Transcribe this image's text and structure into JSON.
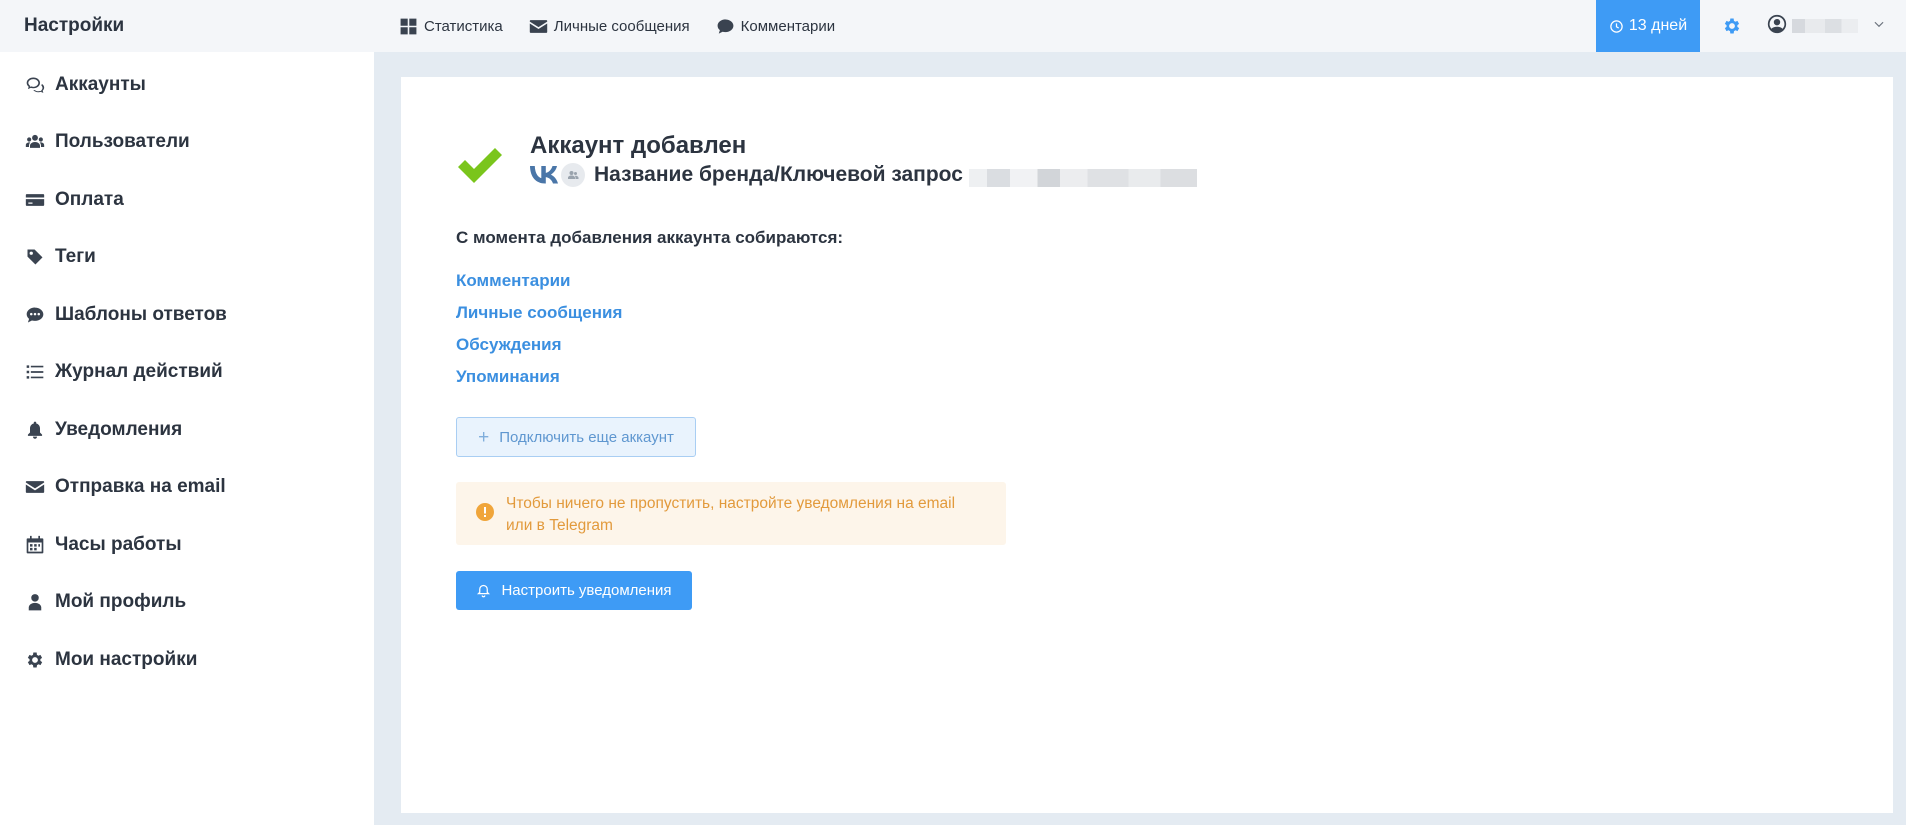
{
  "sidebar": {
    "title": "Настройки",
    "items": [
      {
        "label": "Аккаунты",
        "icon": "chat-icon"
      },
      {
        "label": "Пользователи",
        "icon": "users-icon"
      },
      {
        "label": "Оплата",
        "icon": "credit-card-icon"
      },
      {
        "label": "Теги",
        "icon": "tag-icon"
      },
      {
        "label": "Шаблоны ответов",
        "icon": "comment-dots-icon"
      },
      {
        "label": "Журнал действий",
        "icon": "list-icon"
      },
      {
        "label": "Уведомления",
        "icon": "bell-icon"
      },
      {
        "label": "Отправка на email",
        "icon": "envelope-icon"
      },
      {
        "label": "Часы работы",
        "icon": "calendar-icon"
      },
      {
        "label": "Мой профиль",
        "icon": "user-icon"
      },
      {
        "label": "Мои настройки",
        "icon": "gear-icon"
      }
    ]
  },
  "topbar": {
    "nav": [
      {
        "label": "Статистика",
        "icon": "grid-icon"
      },
      {
        "label": "Личные сообщения",
        "icon": "envelope-icon"
      },
      {
        "label": "Комментарии",
        "icon": "comment-icon"
      }
    ],
    "trial": "13 дней"
  },
  "main": {
    "title": "Аккаунт добавлен",
    "account_name": "Название бренда/Ключевой запрос",
    "collect_label": "С момента добавления аккаунта собираются:",
    "collect_items": [
      "Комментарии",
      "Личные сообщения",
      "Обсуждения",
      "Упоминания"
    ],
    "connect_button": "Подключить еще аккаунт",
    "warning": "Чтобы ничего не пропустить, настройте уведомления на email или в Telegram",
    "notify_button": "Настроить уведомления"
  },
  "colors": {
    "accent": "#3e9bf5",
    "success": "#7ac51c",
    "warning": "#f0a53a",
    "link": "#3b8fe0"
  }
}
